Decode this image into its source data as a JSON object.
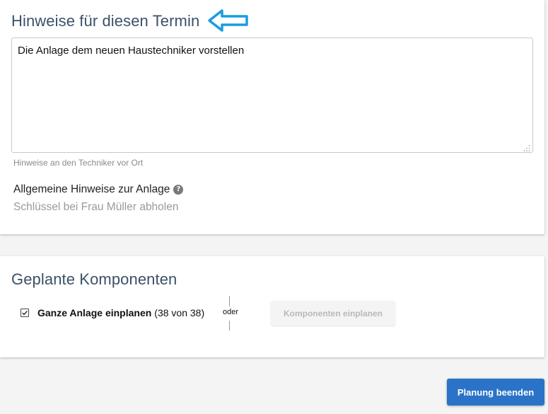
{
  "notes_section": {
    "title": "Hinweise für diesen Termin",
    "textarea_value": "Die Anlage dem neuen Haustechniker vorstellen",
    "helper_text": "Hinweise an den Techniker vor Ort",
    "general_label": "Allgemeine Hinweise zur Anlage",
    "general_value": "Schlüssel bei Frau Müller abholen",
    "help_icon_glyph": "?",
    "arrow_icon": "arrow-left-outline-icon",
    "arrow_color": "#1a9be0"
  },
  "components_section": {
    "title": "Geplante Komponenten",
    "checkbox_checked": true,
    "checkbox_label": "Ganze Anlage einplanen",
    "checkbox_count": "(38 von 38)",
    "or_label": "oder",
    "components_button_label": "Komponenten einplanen"
  },
  "footer": {
    "finish_button_label": "Planung beenden",
    "finish_button_color": "#2b73c8"
  },
  "colors": {
    "title_color": "#3b5168",
    "page_background": "#f4f4f4"
  }
}
